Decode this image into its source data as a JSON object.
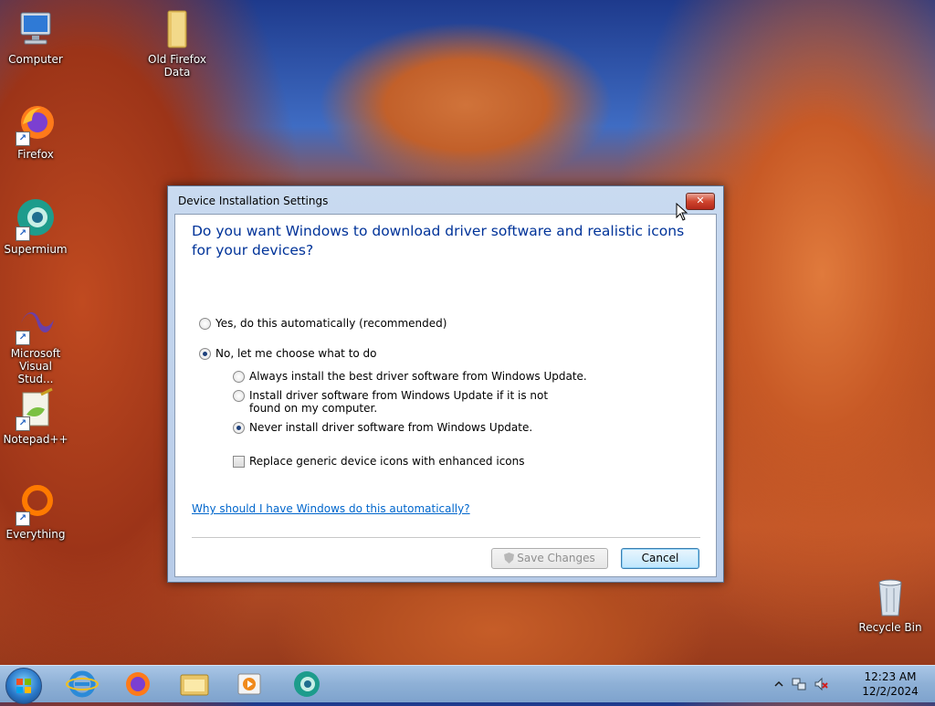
{
  "desktop": {
    "icons": [
      {
        "label": "Computer",
        "icon": "computer-icon"
      },
      {
        "label": "Old Firefox Data",
        "icon": "folder-icon"
      },
      {
        "label": "Firefox",
        "icon": "firefox-icon"
      },
      {
        "label": "Supermium",
        "icon": "supermium-icon"
      },
      {
        "label": "Microsoft Visual Stud...",
        "icon": "visual-studio-icon"
      },
      {
        "label": "Notepad++",
        "icon": "notepadpp-icon"
      },
      {
        "label": "Everything",
        "icon": "everything-icon"
      },
      {
        "label": "Recycle Bin",
        "icon": "recycle-bin-icon"
      }
    ]
  },
  "dialog": {
    "title": "Device Installation Settings",
    "close_label": "✕",
    "question": "Do you want Windows to download driver software and realistic icons for your devices?",
    "options": [
      {
        "label": "Yes, do this automatically (recommended)",
        "checked": false
      },
      {
        "label": "No, let me choose what to do",
        "checked": true
      }
    ],
    "sub_options": [
      {
        "label": "Always install the best driver software from Windows Update.",
        "checked": false
      },
      {
        "label": "Install driver software from Windows Update if it is not found on my computer.",
        "checked": false
      },
      {
        "label": "Never install driver software from Windows Update.",
        "checked": true
      }
    ],
    "checkbox": {
      "label": "Replace generic device icons with enhanced icons",
      "checked": false
    },
    "help_link": "Why should I have Windows do this automatically?",
    "save_label": "Save Changes",
    "cancel_label": "Cancel"
  },
  "taskbar": {
    "pinned": [
      "internet-explorer-icon",
      "firefox-icon",
      "explorer-icon",
      "media-player-icon",
      "supermium-icon"
    ],
    "clock_time": "12:23 AM",
    "clock_date": "12/2/2024"
  },
  "colors": {
    "question_text": "#003399",
    "link": "#0066cc",
    "taskbar": "#8eb0d6"
  }
}
